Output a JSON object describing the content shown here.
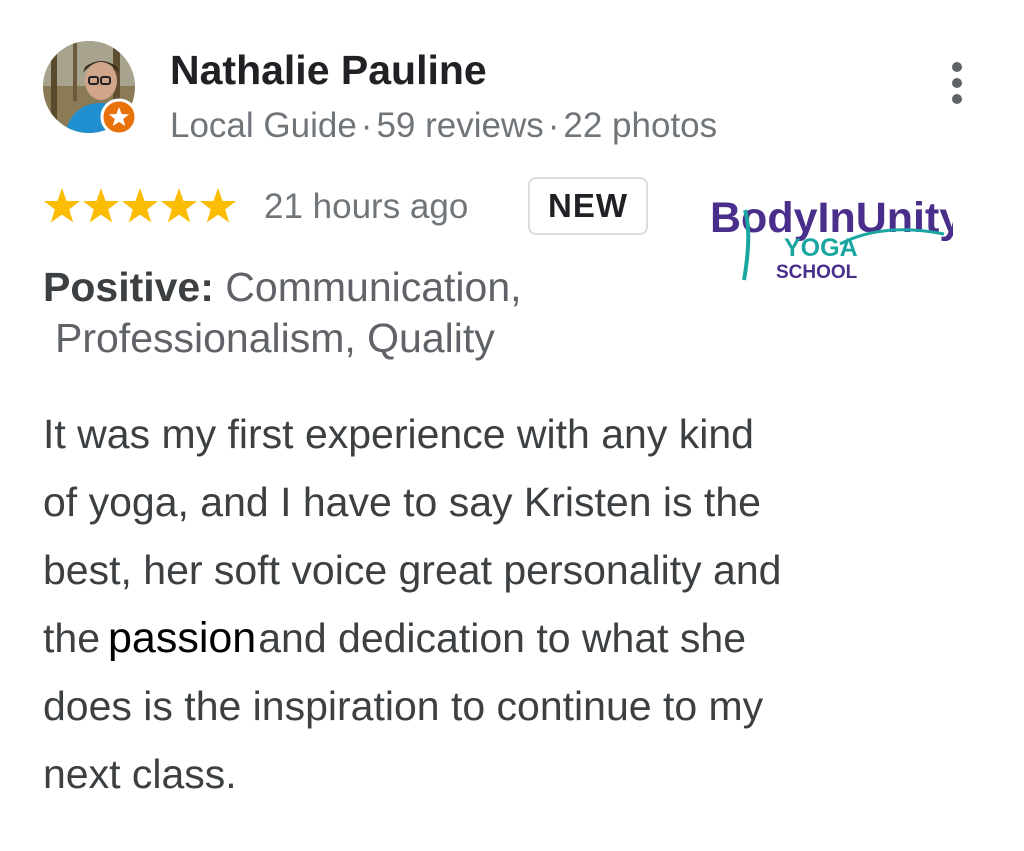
{
  "reviewer": {
    "name": "Nathalie Pauline",
    "role": "Local Guide",
    "reviews": "59 reviews",
    "photos": "22 photos",
    "separator": "·"
  },
  "review": {
    "rating": 5,
    "time": "21 hours ago",
    "badge": "NEW",
    "positive_label": "Positive:",
    "positive_line1": "Communication,",
    "positive_line2": "Professionalism, Quality",
    "text_lines": [
      "It was my first experience with any kind",
      "of yoga, and I have to say Kristen is the",
      "best, her soft voice great personality and",
      "the",
      "and dedication to what she",
      "does is the inspiration to continue to my",
      "next class."
    ],
    "overlay_word": "passion"
  },
  "logo": {
    "brand": "BodyInUnity",
    "line2": "YOGA",
    "line3": "SCHOOL"
  },
  "colors": {
    "star": "#fbbc04",
    "name": "#202124",
    "meta": "#70757a",
    "body": "#3c4043",
    "logo_purple": "#4a2e8c",
    "logo_teal": "#1aa7a2",
    "badge_orange": "#e8710a"
  },
  "icons": {
    "avatar": "profile-photo",
    "guide_badge": "local-guide-star-icon",
    "menu": "more-vert-icon",
    "star": "star-icon"
  }
}
